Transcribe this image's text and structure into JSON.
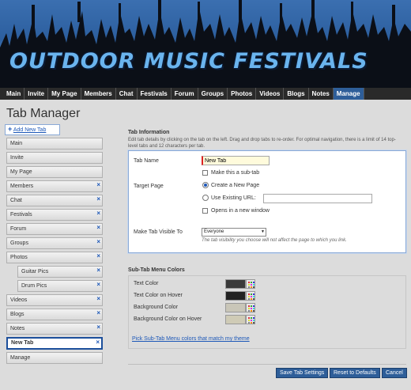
{
  "banner": {
    "title": "OUTDOOR MUSIC FESTIVALS"
  },
  "nav": {
    "items": [
      "Main",
      "Invite",
      "My Page",
      "Members",
      "Chat",
      "Festivals",
      "Forum",
      "Groups",
      "Photos",
      "Videos",
      "Blogs",
      "Notes",
      "Manage"
    ],
    "active": "Manage"
  },
  "page_title": "Tab Manager",
  "add_tab": {
    "icon": "plus-icon",
    "label": "Add New Tab"
  },
  "tabs": [
    {
      "label": "Main",
      "removable": false
    },
    {
      "label": "Invite",
      "removable": false
    },
    {
      "label": "My Page",
      "removable": false
    },
    {
      "label": "Members",
      "removable": true
    },
    {
      "label": "Chat",
      "removable": true
    },
    {
      "label": "Festivals",
      "removable": true
    },
    {
      "label": "Forum",
      "removable": true
    },
    {
      "label": "Groups",
      "removable": true
    },
    {
      "label": "Photos",
      "removable": true
    },
    {
      "label": "Guitar Pics",
      "removable": true,
      "sub": true
    },
    {
      "label": "Drum Pics",
      "removable": true,
      "sub": true
    },
    {
      "label": "Videos",
      "removable": true
    },
    {
      "label": "Blogs",
      "removable": true
    },
    {
      "label": "Notes",
      "removable": true
    },
    {
      "label": "New Tab",
      "removable": true,
      "selected": true
    },
    {
      "label": "Manage",
      "removable": false
    }
  ],
  "remove_icon": "×",
  "info": {
    "heading": "Tab Information",
    "description": "Edit tab details by clicking on the tab on the left. Drag and drop tabs to re-order. For optimal navigation, there is a limit of 14 top-level tabs and 12 characters per tab.",
    "tab_name_label": "Tab Name",
    "tab_name_value": "New Tab",
    "subtab_label": "Make this a sub-tab",
    "target_label": "Target Page",
    "create_new_label": "Create a New Page",
    "use_existing_label": "Use Existing URL:",
    "url_value": "",
    "new_window_label": "Opens in a new window",
    "visible_label": "Make Tab Visible To",
    "visible_value": "Everyone",
    "visible_note": "The tab visibility you choose will not affect the page to which you link."
  },
  "subtab_colors": {
    "heading": "Sub-Tab Menu Colors",
    "rows": [
      {
        "label": "Text Color",
        "color": "#3a3a3a"
      },
      {
        "label": "Text Color on Hover",
        "color": "#222222"
      },
      {
        "label": "Background Color",
        "color": "#c9c6b8"
      },
      {
        "label": "Background Color on Hover",
        "color": "#cfcbb6"
      }
    ],
    "match_link": "Pick Sub-Tab Menu colors that match my theme"
  },
  "buttons": {
    "save": "Save Tab Settings",
    "reset": "Reset to Defaults",
    "cancel": "Cancel"
  },
  "colors": {
    "accent": "#2e5e99",
    "nav_bg": "#2a2a2a",
    "link": "#1d58b8"
  }
}
